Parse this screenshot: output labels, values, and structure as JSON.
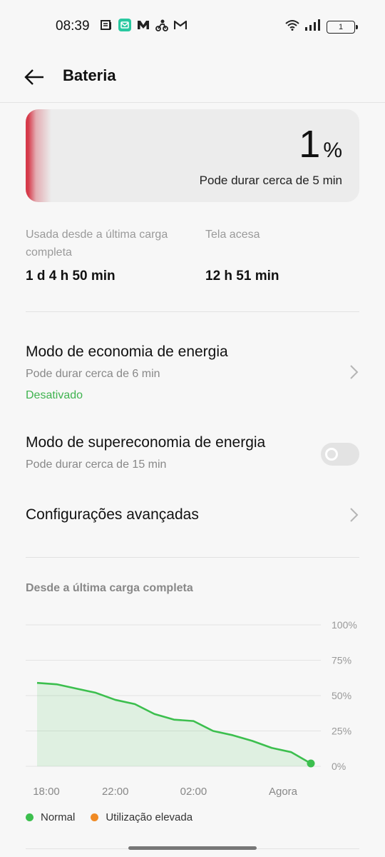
{
  "status_bar": {
    "time": "08:39",
    "notification_icons": [
      "news-icon",
      "mail-app-icon",
      "m-app-icon",
      "delivery-icon",
      "gmail-icon"
    ],
    "battery_level": "1"
  },
  "header": {
    "title": "Bateria"
  },
  "battery_card": {
    "percent": "1",
    "percent_sign": "%",
    "estimate": "Pode durar cerca de 5 min",
    "accent_color": "#d63a4a"
  },
  "stats": {
    "used_label": "Usada desde a última carga completa",
    "used_value": "1 d 4 h 50 min",
    "screen_label": "Tela acesa",
    "screen_value": "12 h 51 min"
  },
  "settings": {
    "power_saving": {
      "title": "Modo de economia de energia",
      "subtitle": "Pode durar cerca de 6 min",
      "status": "Desativado"
    },
    "super_saving": {
      "title": "Modo de supereconomia de energia",
      "subtitle": "Pode durar cerca de 15 min",
      "enabled": false
    },
    "advanced": {
      "title": "Configurações avançadas"
    }
  },
  "chart_section": {
    "title": "Desde a última carga completa"
  },
  "chart_data": {
    "type": "area",
    "x": [
      "18:00",
      "19:00",
      "20:00",
      "21:00",
      "22:00",
      "23:00",
      "00:00",
      "01:00",
      "02:00",
      "03:00",
      "04:00",
      "05:00",
      "06:00",
      "07:00",
      "Agora"
    ],
    "x_tick_labels": [
      "18:00",
      "22:00",
      "02:00",
      "Agora"
    ],
    "series": [
      {
        "name": "Normal",
        "color": "#3cbf4e",
        "values": [
          59,
          58,
          55,
          52,
          47,
          44,
          37,
          33,
          32,
          25,
          22,
          18,
          13,
          10,
          2
        ]
      }
    ],
    "y_tick_labels": [
      "100%",
      "75%",
      "50%",
      "25%",
      "0%"
    ],
    "ylim": [
      0,
      100
    ],
    "grid": true,
    "legend": [
      {
        "name": "Normal",
        "color": "#3cbf4e"
      },
      {
        "name": "Utilização elevada",
        "color": "#f08a24"
      }
    ]
  }
}
